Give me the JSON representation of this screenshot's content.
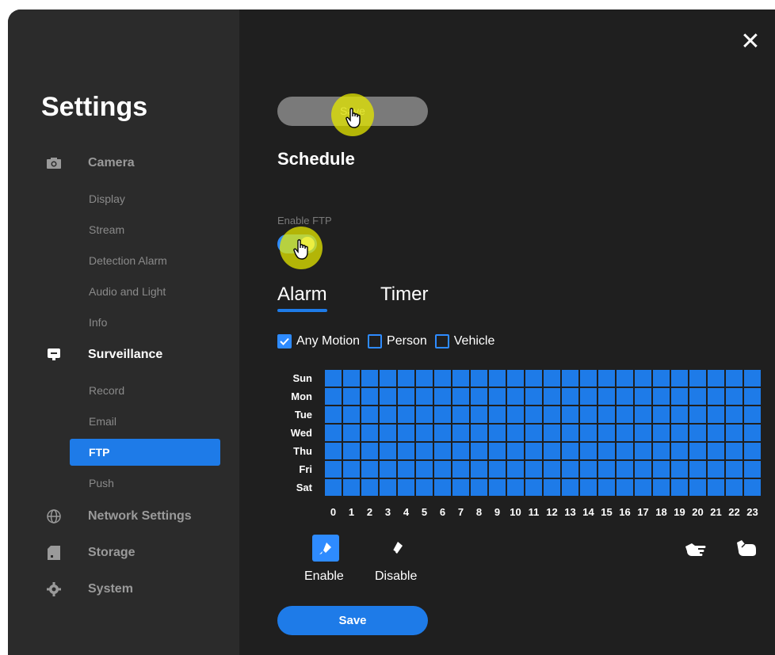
{
  "settings": {
    "title": "Settings"
  },
  "sidebar": {
    "groups": [
      {
        "label": "Camera",
        "icon": "camera-icon"
      },
      {
        "label": "Surveillance",
        "icon": "monitor-icon"
      },
      {
        "label": "Network Settings",
        "icon": "globe-icon"
      },
      {
        "label": "Storage",
        "icon": "storage-icon"
      },
      {
        "label": "System",
        "icon": "gear-icon"
      }
    ],
    "camera_items": [
      "Display",
      "Stream",
      "Detection Alarm",
      "Audio and Light",
      "Info"
    ],
    "surveillance_items": [
      "Record",
      "Email",
      "FTP",
      "Push"
    ],
    "active_item": "FTP"
  },
  "main": {
    "top_button_label": "Save",
    "schedule_title": "Schedule",
    "enable_ftp_label": "Enable FTP",
    "enable_ftp_on": true,
    "tabs": [
      {
        "label": "Alarm",
        "active": true
      },
      {
        "label": "Timer",
        "active": false
      }
    ],
    "checkboxes": [
      {
        "label": "Any Motion",
        "checked": true
      },
      {
        "label": "Person",
        "checked": false
      },
      {
        "label": "Vehicle",
        "checked": false
      }
    ],
    "days": [
      "Sun",
      "Mon",
      "Tue",
      "Wed",
      "Thu",
      "Fri",
      "Sat"
    ],
    "hours": [
      "0",
      "1",
      "2",
      "3",
      "4",
      "5",
      "6",
      "7",
      "8",
      "9",
      "10",
      "11",
      "12",
      "13",
      "14",
      "15",
      "16",
      "17",
      "18",
      "19",
      "20",
      "21",
      "22",
      "23"
    ],
    "tools": {
      "enable_label": "Enable",
      "disable_label": "Disable"
    },
    "save_label": "Save"
  },
  "colors": {
    "accent": "#1e7be8",
    "sidebar_bg": "#2b2b2b",
    "main_bg": "#1f1f1f",
    "highlight": "#e6e800"
  }
}
